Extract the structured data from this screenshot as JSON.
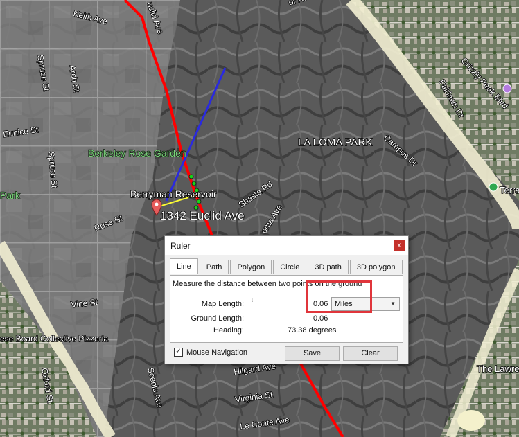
{
  "map": {
    "labels": {
      "keith_ave": "Keith Ave",
      "euclid_ave_top": "uclid Ave",
      "top_ave": "or Ave",
      "spruce_st_upper": "Spruce St",
      "spruce_st_lower": "Spruce St",
      "arch_st": "Arch St",
      "eunice_st": "Eunice St",
      "berkeley_rose_garden": "Berkeley Rose Garden",
      "park_left": "Park",
      "berryman_reservoir": "Berryman Reservoir",
      "address": "1342 Euclid Ave",
      "rose_st": "Rose St",
      "shasta_rd": "Shasta Rd",
      "la_loma_ave": "oma Ave",
      "la_loma_park": "LA LOMA PARK",
      "campus_dr": "Campus Dr",
      "grizzly_peak_blvd": "Grizzly Peak Blvd",
      "fairlawn_dr": "Fairlawn Dr",
      "terra": "Terra",
      "vine_st": "Vine St",
      "cheese_board": "ese Board Collective Pizzeria",
      "hilgard_ave": "Hilgard Ave",
      "virginia_st": "Virginia St",
      "le_conte_ave": "Le Conte Ave",
      "scenic_ave": "Scenic Ave",
      "oxford_st": "Oxford St",
      "the_lawrence": "The Lawre"
    },
    "colors": {
      "ruler_line": "#ff0000",
      "blue_line": "#2a2adf",
      "yellow_line": "#ffff33",
      "path_dots": "#17d41a",
      "terrain": "#5e5e5e",
      "boundary": "#f2eed2"
    }
  },
  "dialog": {
    "title": "Ruler",
    "close": "x",
    "tabs": [
      "Line",
      "Path",
      "Polygon",
      "Circle",
      "3D path",
      "3D polygon"
    ],
    "description": "Measure the distance between two points on the ground",
    "map_length_label": "Map Length:",
    "map_length_value": "0.06",
    "units": "Miles",
    "ground_length_label": "Ground Length:",
    "ground_length_value": "0.06",
    "heading_label": "Heading:",
    "heading_value": "73.38 degrees",
    "mouse_navigation": "Mouse Navigation",
    "mouse_navigation_checked": true,
    "save": "Save",
    "clear": "Clear"
  }
}
